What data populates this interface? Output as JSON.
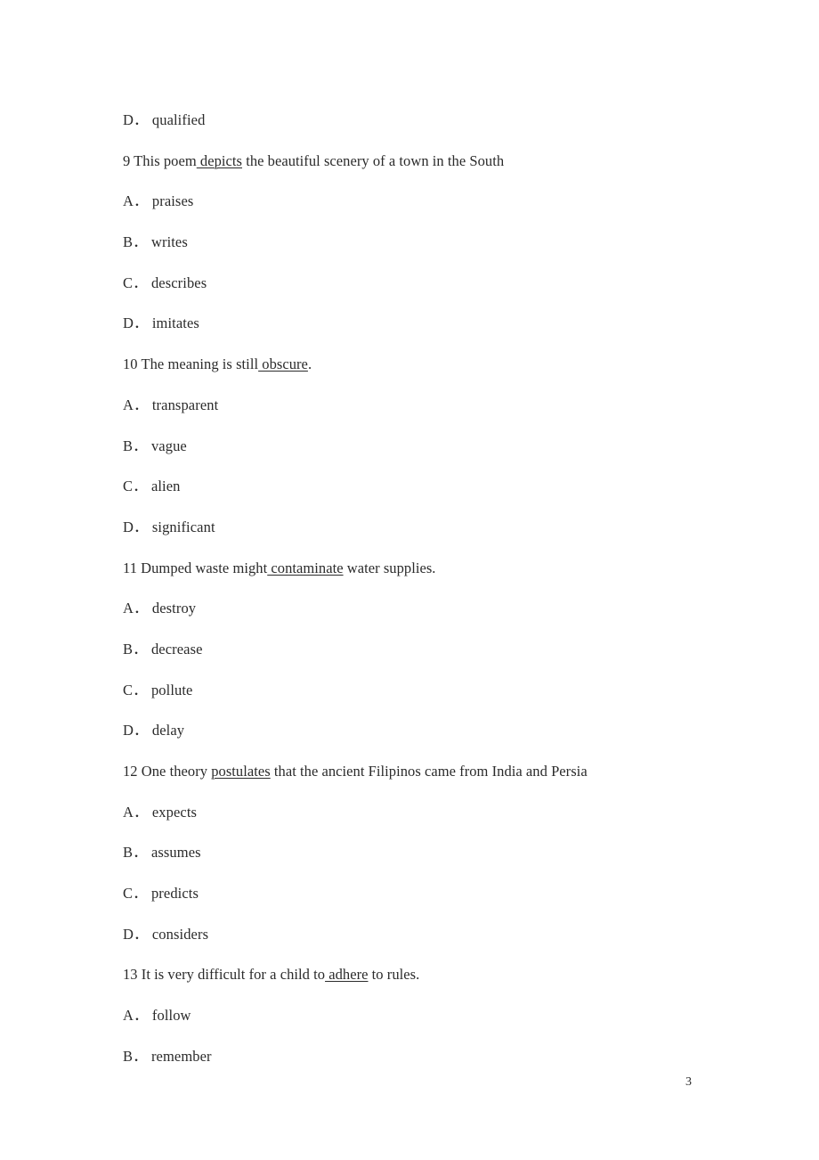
{
  "document": {
    "page_number": "3",
    "lines": [
      {
        "kind": "option",
        "letter": "D",
        "separator": "．",
        "text": "qualified",
        "full_text": "D． qualified"
      },
      {
        "kind": "question",
        "number": "9",
        "text_before": "9 This poem",
        "underlined": " depicts",
        "text_after": " the beautiful scenery of a town in the South",
        "full_text": "9 This poem depicts the beautiful scenery of a town in the South"
      },
      {
        "kind": "option",
        "letter": "A",
        "separator": "．",
        "text": "praises",
        "full_text": "A． praises"
      },
      {
        "kind": "option",
        "letter": "B",
        "separator": "．",
        "text": "writes",
        "full_text": "B． writes"
      },
      {
        "kind": "option",
        "letter": "C",
        "separator": "．",
        "text": "describes",
        "full_text": "C． describes"
      },
      {
        "kind": "option",
        "letter": "D",
        "separator": "．",
        "text": "imitates",
        "full_text": "D． imitates"
      },
      {
        "kind": "question",
        "number": "10",
        "text_before": "10 The meaning is still",
        "underlined": " obscure",
        "text_after": ".",
        "full_text": "10 The meaning is still obscure."
      },
      {
        "kind": "option",
        "letter": "A",
        "separator": "．",
        "text": "transparent",
        "full_text": "A． transparent"
      },
      {
        "kind": "option",
        "letter": "B",
        "separator": "．",
        "text": "vague",
        "full_text": "B． vague"
      },
      {
        "kind": "option",
        "letter": "C",
        "separator": "．",
        "text": "alien",
        "full_text": "C． alien"
      },
      {
        "kind": "option",
        "letter": "D",
        "separator": "．",
        "text": "significant",
        "full_text": "D． significant"
      },
      {
        "kind": "question",
        "number": "11",
        "text_before": "11 Dumped waste might",
        "underlined": " contaminate",
        "text_after": " water supplies.",
        "full_text": "11 Dumped waste might contaminate water supplies."
      },
      {
        "kind": "option",
        "letter": "A",
        "separator": "．",
        "text": "destroy",
        "full_text": "A． destroy"
      },
      {
        "kind": "option",
        "letter": "B",
        "separator": "．",
        "text": "decrease",
        "full_text": "B． decrease"
      },
      {
        "kind": "option",
        "letter": "C",
        "separator": "．",
        "text": "pollute",
        "full_text": "C． pollute"
      },
      {
        "kind": "option",
        "letter": "D",
        "separator": "．",
        "text": "delay",
        "full_text": "D． delay"
      },
      {
        "kind": "question",
        "number": "12",
        "text_before": "12 One theory ",
        "underlined": "postulates",
        "text_after": " that the ancient Filipinos came from India and Persia",
        "full_text": "12 One theory postulates that the ancient Filipinos came from India and Persia"
      },
      {
        "kind": "option",
        "letter": "A",
        "separator": "．",
        "text": "expects",
        "full_text": "A． expects"
      },
      {
        "kind": "option",
        "letter": "B",
        "separator": "．",
        "text": "assumes",
        "full_text": "B． assumes"
      },
      {
        "kind": "option",
        "letter": "C",
        "separator": "．",
        "text": "predicts",
        "full_text": "C． predicts"
      },
      {
        "kind": "option",
        "letter": "D",
        "separator": "．",
        "text": "considers",
        "full_text": "D． considers"
      },
      {
        "kind": "question",
        "number": "13",
        "text_before": "13 It is very difficult for a child to",
        "underlined": " adhere",
        "text_after": " to rules.",
        "full_text": "13 It is very difficult for a child to adhere to rules."
      },
      {
        "kind": "option",
        "letter": "A",
        "separator": "．",
        "text": "follow",
        "full_text": "A． follow"
      },
      {
        "kind": "option",
        "letter": "B",
        "separator": "．",
        "text": "remember",
        "full_text": "B． remember"
      }
    ]
  }
}
